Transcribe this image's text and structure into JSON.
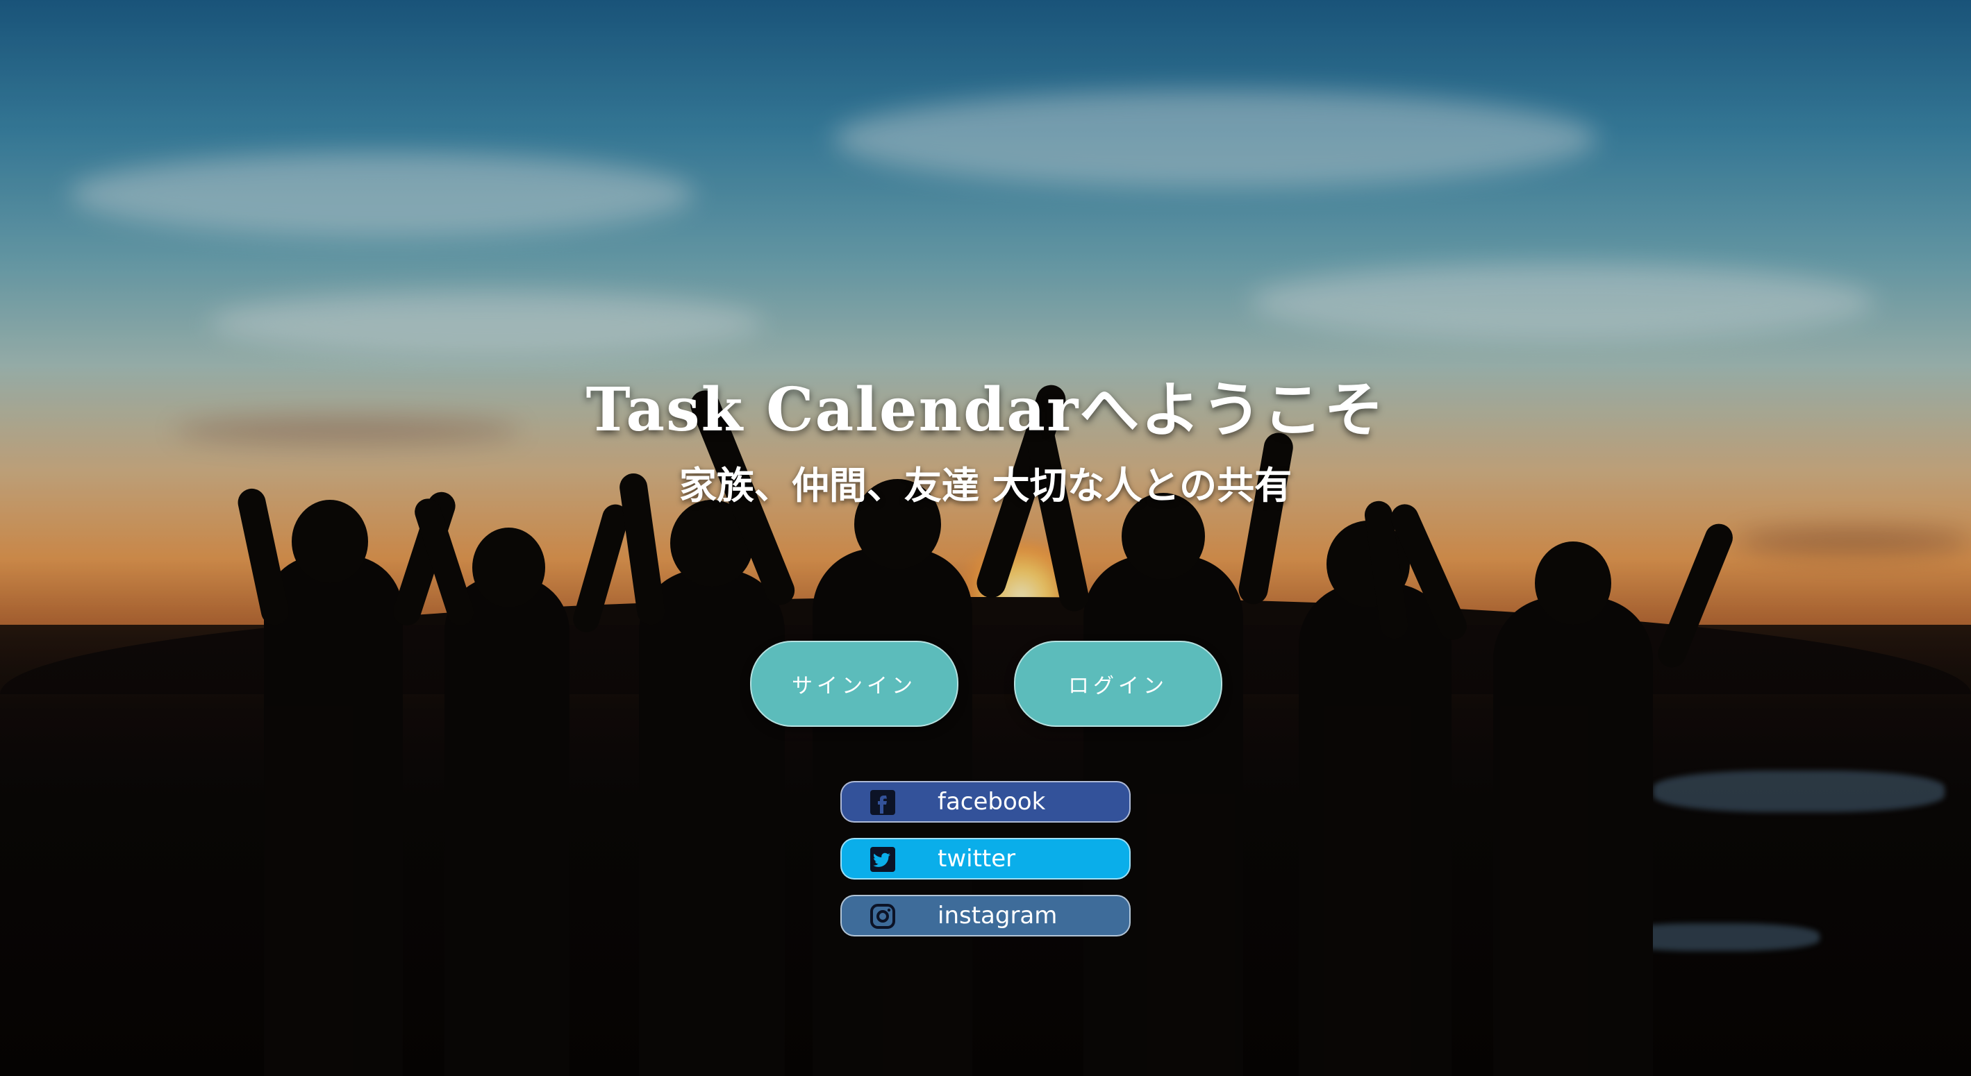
{
  "page": {
    "title": "Task Calendarへようこそ",
    "subtitle": "家族、仲間、友達 大切な人との共有"
  },
  "auth": {
    "signin_label": "サインイン",
    "login_label": "ログイン"
  },
  "social": {
    "facebook": {
      "label": "facebook",
      "icon": "facebook-icon",
      "color": "#33529a"
    },
    "twitter": {
      "label": "twitter",
      "icon": "twitter-icon",
      "color": "#0aaeea"
    },
    "instagram": {
      "label": "instagram",
      "icon": "instagram-icon",
      "color": "#3e6c9a"
    }
  },
  "colors": {
    "accent": "#5cbcbb"
  }
}
